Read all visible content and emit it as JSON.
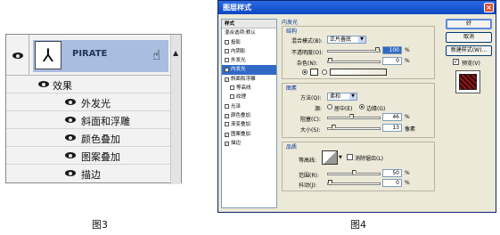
{
  "figure3": {
    "layer_name": "PIRATE",
    "fx_badge": "ℱ",
    "effects_label": "效果",
    "effects": [
      "外发光",
      "斜面和浮雕",
      "颜色叠加",
      "图案叠加",
      "描边"
    ],
    "caption": "图3"
  },
  "figure4": {
    "title": "图层样式",
    "close": "×",
    "style_list": [
      {
        "label": "样式",
        "type": "header"
      },
      {
        "label": "混合选项:默认",
        "type": "plain"
      },
      {
        "label": "投影",
        "checked": false
      },
      {
        "label": "内阴影",
        "checked": false
      },
      {
        "label": "外发光",
        "checked": false
      },
      {
        "label": "内发光",
        "checked": true,
        "selected": true
      },
      {
        "label": "斜面和浮雕",
        "checked": true
      },
      {
        "label": "等高线",
        "checked": false,
        "indent": true
      },
      {
        "label": "纹理",
        "checked": false,
        "indent": true
      },
      {
        "label": "光泽",
        "checked": false
      },
      {
        "label": "颜色叠加",
        "checked": true
      },
      {
        "label": "渐变叠加",
        "checked": false
      },
      {
        "label": "图案叠加",
        "checked": true
      },
      {
        "label": "描边",
        "checked": true
      }
    ],
    "section_title": "内发光",
    "structure": {
      "title": "结构",
      "blend_mode_label": "混合模式(B):",
      "blend_mode_value": "正片叠底",
      "opacity_label": "不透明度(O):",
      "opacity_value": "100",
      "opacity_fraction": 1.0,
      "noise_label": "杂色(N):",
      "noise_value": "0",
      "noise_fraction": 0.0,
      "percent": "%"
    },
    "elements": {
      "title": "图素",
      "method_label": "方法(Q):",
      "method_value": "柔和",
      "source_label": "源:",
      "center_label": "居中(E)",
      "edge_label": "边缘(G)",
      "choke_label": "阻塞(C):",
      "choke_value": "46",
      "choke_fraction": 0.46,
      "size_label": "大小(S):",
      "size_value": "13",
      "size_fraction": 0.07,
      "px": "像素"
    },
    "quality": {
      "title": "品质",
      "contour_label": "等高线:",
      "antialias_label": "消除锯齿(L)",
      "range_label": "范围(R):",
      "range_value": "50",
      "range_fraction": 0.5,
      "jitter_label": "抖动(J):",
      "jitter_value": "0",
      "jitter_fraction": 0.0
    },
    "buttons": {
      "ok": "好",
      "cancel": "取消",
      "new_style": "新建样式(W)...",
      "preview": "预览(V)"
    },
    "caption": "图4"
  }
}
